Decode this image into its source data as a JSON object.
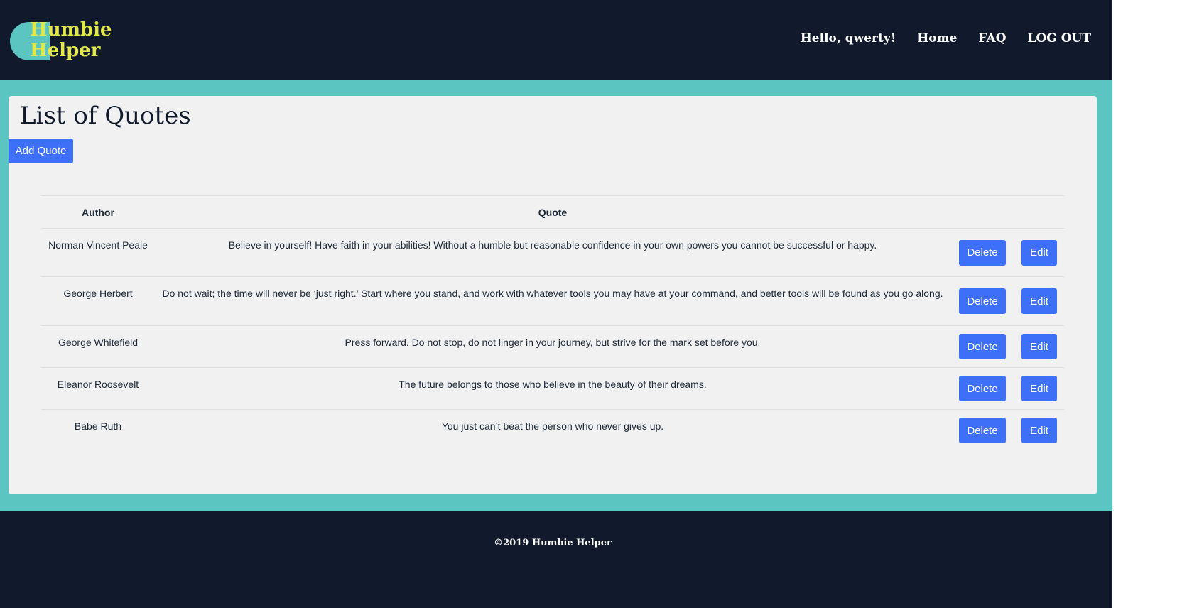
{
  "brand": {
    "name_line1": "Humbie",
    "name_line2": "Helper",
    "logo_color": "#e3e84a",
    "accent_color": "#5bc5c1"
  },
  "nav": {
    "greeting": "Hello, qwerty!",
    "home": "Home",
    "faq": "FAQ",
    "logout": "LOG OUT"
  },
  "main": {
    "title": "List of Quotes",
    "add_button": "Add Quote"
  },
  "table": {
    "headers": {
      "author": "Author",
      "quote": "Quote"
    },
    "delete_label": "Delete",
    "edit_label": "Edit",
    "rows": [
      {
        "author": "Norman Vincent Peale",
        "quote": "Believe in yourself! Have faith in your abilities! Without a humble but reasonable confidence in your own powers you cannot be successful or happy."
      },
      {
        "author": "George Herbert",
        "quote": "Do not wait; the time will never be ‘just right.’ Start where you stand, and work with whatever tools you may have at your command, and better tools will be found as you go along."
      },
      {
        "author": "George Whitefield",
        "quote": "Press forward. Do not stop, do not linger in your journey, but strive for the mark set before you."
      },
      {
        "author": "Eleanor Roosevelt",
        "quote": "The future belongs to those who believe in the beauty of their dreams."
      },
      {
        "author": "Babe Ruth",
        "quote": "You just can’t beat the person who never gives up."
      }
    ]
  },
  "footer": {
    "text": "©2019 Humbie Helper"
  },
  "colors": {
    "navbar": "#111a2d",
    "button": "#3d6ff9",
    "card": "#f1f1f1"
  }
}
